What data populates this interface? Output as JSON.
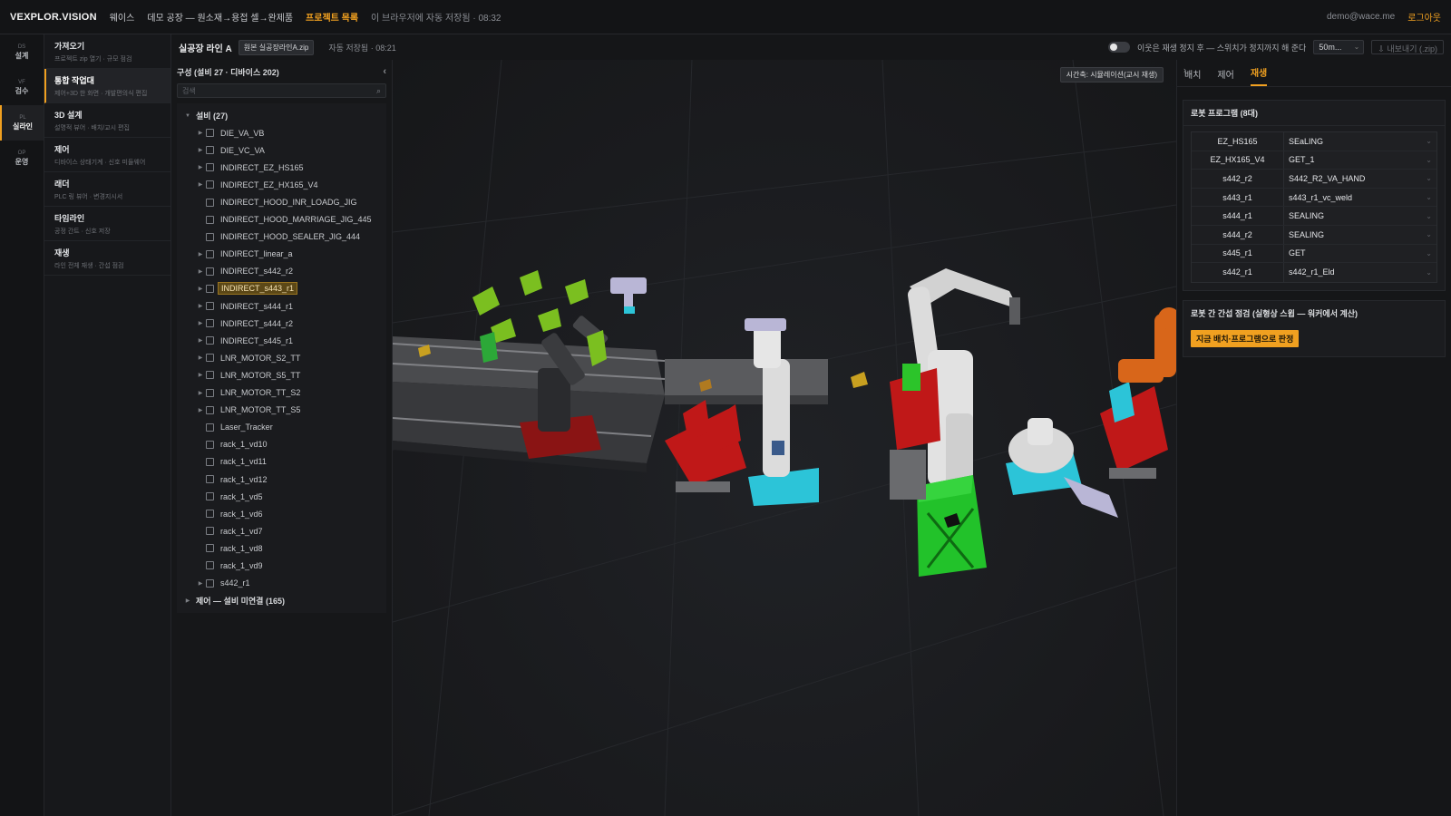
{
  "topbar": {
    "brand": "VEXPLOR.VISION",
    "links": [
      "웨이스",
      "데모 공장 — 원소재→용접 셀→완제품"
    ],
    "project_list": "프로젝트 목록",
    "autosave_note": "이 브라우저에 자동 저장됨 · 08:32",
    "user_email": "demo@wace.me",
    "logout": "로그아웃"
  },
  "rail": [
    {
      "code": "DS",
      "label": "설계",
      "active": false
    },
    {
      "code": "VF",
      "label": "검수",
      "active": false
    },
    {
      "code": "PL",
      "label": "실라인",
      "active": true
    },
    {
      "code": "OP",
      "label": "운영",
      "active": false
    }
  ],
  "modes": [
    {
      "title": "가져오기",
      "sub": "프로젝트 zip 열기 · 규모 점검",
      "active": false
    },
    {
      "title": "통합 작업대",
      "sub": "제어+3D 한 화면 · 개발편의식 편집",
      "active": true
    },
    {
      "title": "3D 설계",
      "sub": "설명적 뷰어 · 배치/교시 편집",
      "active": false
    },
    {
      "title": "제어",
      "sub": "디바이스 상태기계 · 신호 미들웨어",
      "active": false
    },
    {
      "title": "래더",
      "sub": "PLC 링 뷰어 · 변경지시서",
      "active": false
    },
    {
      "title": "타임라인",
      "sub": "공정 간트 · 신호 저장",
      "active": false
    },
    {
      "title": "재생",
      "sub": "라인 전체 재생 · 간섭 점검",
      "active": false
    }
  ],
  "subhead": {
    "line_title": "실공장 라인 A",
    "zip_badge": "원본 실공장라인A.zip",
    "autosave": "자동 저장됨 · 08:21",
    "toggle_text": "이웃은 재생 정지 후 — 스위치가 정지까지 해 준다",
    "speed": "50m...",
    "export": "⇩ 내보내기 (.zip)"
  },
  "tree": {
    "header": "구성 (설비 27 · 디바이스 202)",
    "search_placeholder": "검색",
    "root_label": "설비 (27)",
    "items": [
      {
        "label": "DIE_VA_VB",
        "expandable": true,
        "selected": false
      },
      {
        "label": "DIE_VC_VA",
        "expandable": true,
        "selected": false
      },
      {
        "label": "INDIRECT_EZ_HS165",
        "expandable": true,
        "selected": false
      },
      {
        "label": "INDIRECT_EZ_HX165_V4",
        "expandable": true,
        "selected": false
      },
      {
        "label": "INDIRECT_HOOD_INR_LOADG_JIG",
        "expandable": false,
        "selected": false
      },
      {
        "label": "INDIRECT_HOOD_MARRIAGE_JIG_445",
        "expandable": false,
        "selected": false
      },
      {
        "label": "INDIRECT_HOOD_SEALER_JIG_444",
        "expandable": false,
        "selected": false
      },
      {
        "label": "INDIRECT_linear_a",
        "expandable": true,
        "selected": false
      },
      {
        "label": "INDIRECT_s442_r2",
        "expandable": true,
        "selected": false
      },
      {
        "label": "INDIRECT_s443_r1",
        "expandable": true,
        "selected": true
      },
      {
        "label": "INDIRECT_s444_r1",
        "expandable": true,
        "selected": false
      },
      {
        "label": "INDIRECT_s444_r2",
        "expandable": true,
        "selected": false
      },
      {
        "label": "INDIRECT_s445_r1",
        "expandable": true,
        "selected": false
      },
      {
        "label": "LNR_MOTOR_S2_TT",
        "expandable": true,
        "selected": false
      },
      {
        "label": "LNR_MOTOR_S5_TT",
        "expandable": true,
        "selected": false
      },
      {
        "label": "LNR_MOTOR_TT_S2",
        "expandable": true,
        "selected": false
      },
      {
        "label": "LNR_MOTOR_TT_S5",
        "expandable": true,
        "selected": false
      },
      {
        "label": "Laser_Tracker",
        "expandable": false,
        "selected": false
      },
      {
        "label": "rack_1_vd10",
        "expandable": false,
        "selected": false
      },
      {
        "label": "rack_1_vd11",
        "expandable": false,
        "selected": false
      },
      {
        "label": "rack_1_vd12",
        "expandable": false,
        "selected": false
      },
      {
        "label": "rack_1_vd5",
        "expandable": false,
        "selected": false
      },
      {
        "label": "rack_1_vd6",
        "expandable": false,
        "selected": false
      },
      {
        "label": "rack_1_vd7",
        "expandable": false,
        "selected": false
      },
      {
        "label": "rack_1_vd8",
        "expandable": false,
        "selected": false
      },
      {
        "label": "rack_1_vd9",
        "expandable": false,
        "selected": false
      },
      {
        "label": "s442_r1",
        "expandable": true,
        "selected": false
      }
    ],
    "footer_root": "제어 — 설비 미연결 (165)"
  },
  "viewport": {
    "time_badge": "시간축: 시뮬레이션(교시 재생)"
  },
  "right": {
    "tabs": [
      {
        "label": "배치",
        "active": false
      },
      {
        "label": "제어",
        "active": false
      },
      {
        "label": "재생",
        "active": true
      }
    ],
    "program_title": "로봇 프로그램 (8대)",
    "programs": [
      {
        "robot": "EZ_HS165",
        "program": "SEaLING"
      },
      {
        "robot": "EZ_HX165_V4",
        "program": "GET_1"
      },
      {
        "robot": "s442_r2",
        "program": "S442_R2_VA_HAND"
      },
      {
        "robot": "s443_r1",
        "program": "s443_r1_vc_weld"
      },
      {
        "robot": "s444_r1",
        "program": "SEALING"
      },
      {
        "robot": "s444_r2",
        "program": "SEALING"
      },
      {
        "robot": "s445_r1",
        "program": "GET"
      },
      {
        "robot": "s442_r1",
        "program": "s442_r1_Eld"
      }
    ],
    "interference_title": "로봇 간 간섭 점검 (실형상 스윕 — 워커에서 계산)",
    "confirm_button": "지금 배치·프로그램으로 판정"
  },
  "colors": {
    "accent": "#f0a020",
    "robot_white": "#dcdcdc",
    "fixture_red": "#c01818",
    "stand_cyan": "#2cc4d8",
    "stand_green": "#22c22a",
    "robot_orange": "#d8661a"
  }
}
